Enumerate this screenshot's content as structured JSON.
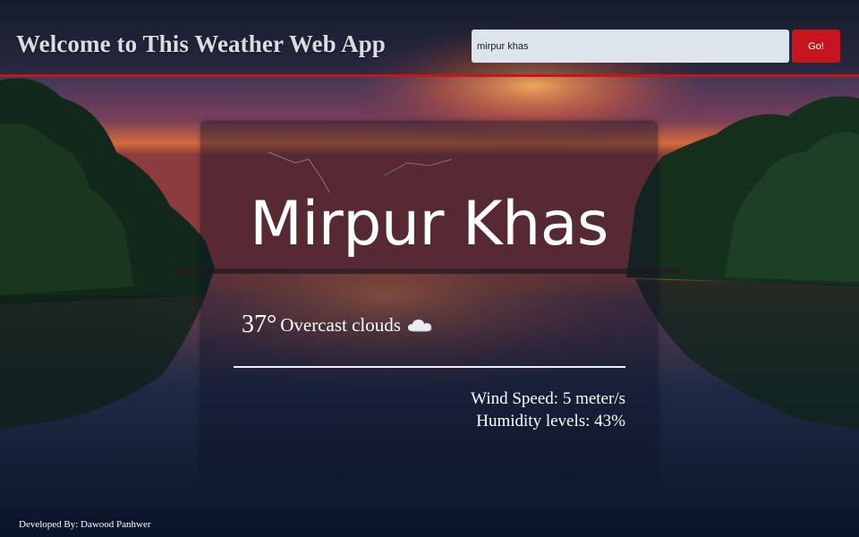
{
  "header": {
    "title": "Welcome to This Weather Web App",
    "search_value": "mirpur khas",
    "go_label": "Go!"
  },
  "weather": {
    "city": "Mirpur Khas",
    "temperature": "37°",
    "description": "Overcast clouds",
    "icon": "cloud-icon",
    "wind_speed": "Wind Speed: 5 meter/s",
    "humidity": "Humidity levels: 43%"
  },
  "footer": {
    "credit": "Developed By: Dawood Panhwer"
  },
  "colors": {
    "accent": "#c4161c",
    "search_bg": "#dde4ec",
    "text": "#ffffff"
  }
}
